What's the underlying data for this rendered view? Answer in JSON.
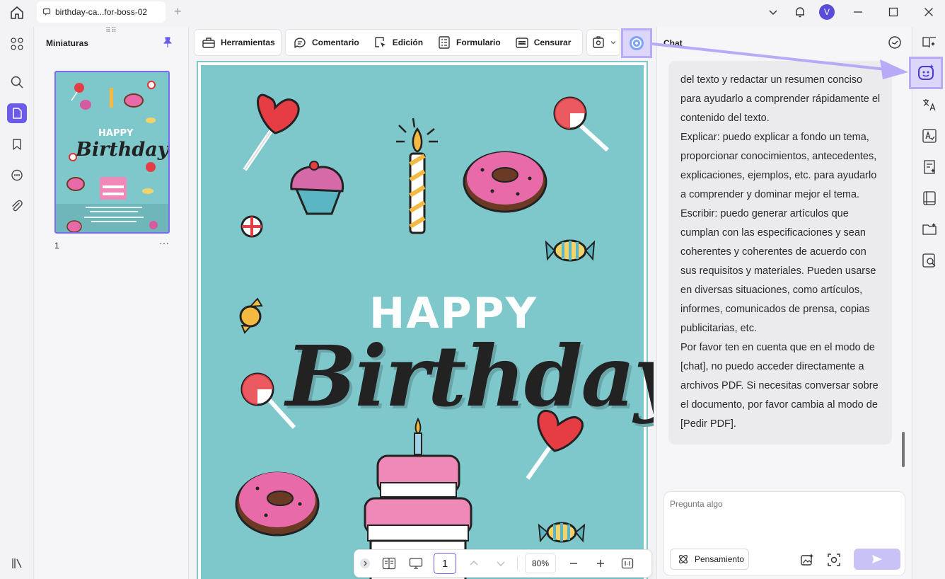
{
  "titlebar": {
    "tab_title": "birthday-ca...for-boss-02",
    "avatar_initial": "V"
  },
  "thumbnails": {
    "title": "Miniaturas",
    "page_number": "1",
    "more": "···"
  },
  "toolbar": {
    "tools": [
      "Herramientas",
      "Comentario",
      "Edición",
      "Formulario",
      "Censurar"
    ]
  },
  "document": {
    "happy": "HAPPY",
    "birthday": "Birthday"
  },
  "bottombar": {
    "page_value": "1",
    "zoom": "80%"
  },
  "chat": {
    "title": "Chat",
    "paragraphs": [
      "del texto y redactar un resumen conciso para ayudarlo a comprender rápidamente el contenido del texto.",
      "Explicar: puedo explicar a fondo un tema, proporcionar conocimientos, antecedentes, explicaciones, ejemplos, etc. para ayudarlo a comprender y dominar mejor el tema.",
      "Escribir: puedo generar artículos que cumplan con las especificaciones y sean coherentes y coherentes de acuerdo con sus requisitos y materiales. Pueden usarse en diversas situaciones, como artículos, informes, comunicados de prensa, copias publicitarias, etc.",
      "Por favor ten en cuenta que en el modo de [chat], no puedo acceder directamente a archivos PDF. Si necesitas conversar sobre el documento, por favor cambia al modo de [Pedir PDF]."
    ],
    "input_placeholder": "Pregunta algo",
    "thinking_label": "Pensamiento"
  },
  "colors": {
    "accent": "#6b5ce7",
    "highlight": "#b8aaf6",
    "page_bg": "#7ec8cc"
  },
  "icons": {
    "left_rail": [
      "grid-icon",
      "search-icon",
      "page-icon",
      "bookmark-icon",
      "comment-icon",
      "attachment-icon"
    ],
    "right_rail": [
      "book-open-icon",
      "ai-assistant-icon",
      "translate-icon",
      "grammar-icon",
      "summarize-icon",
      "reader-icon",
      "folder-icon",
      "ocr-search-icon"
    ]
  }
}
